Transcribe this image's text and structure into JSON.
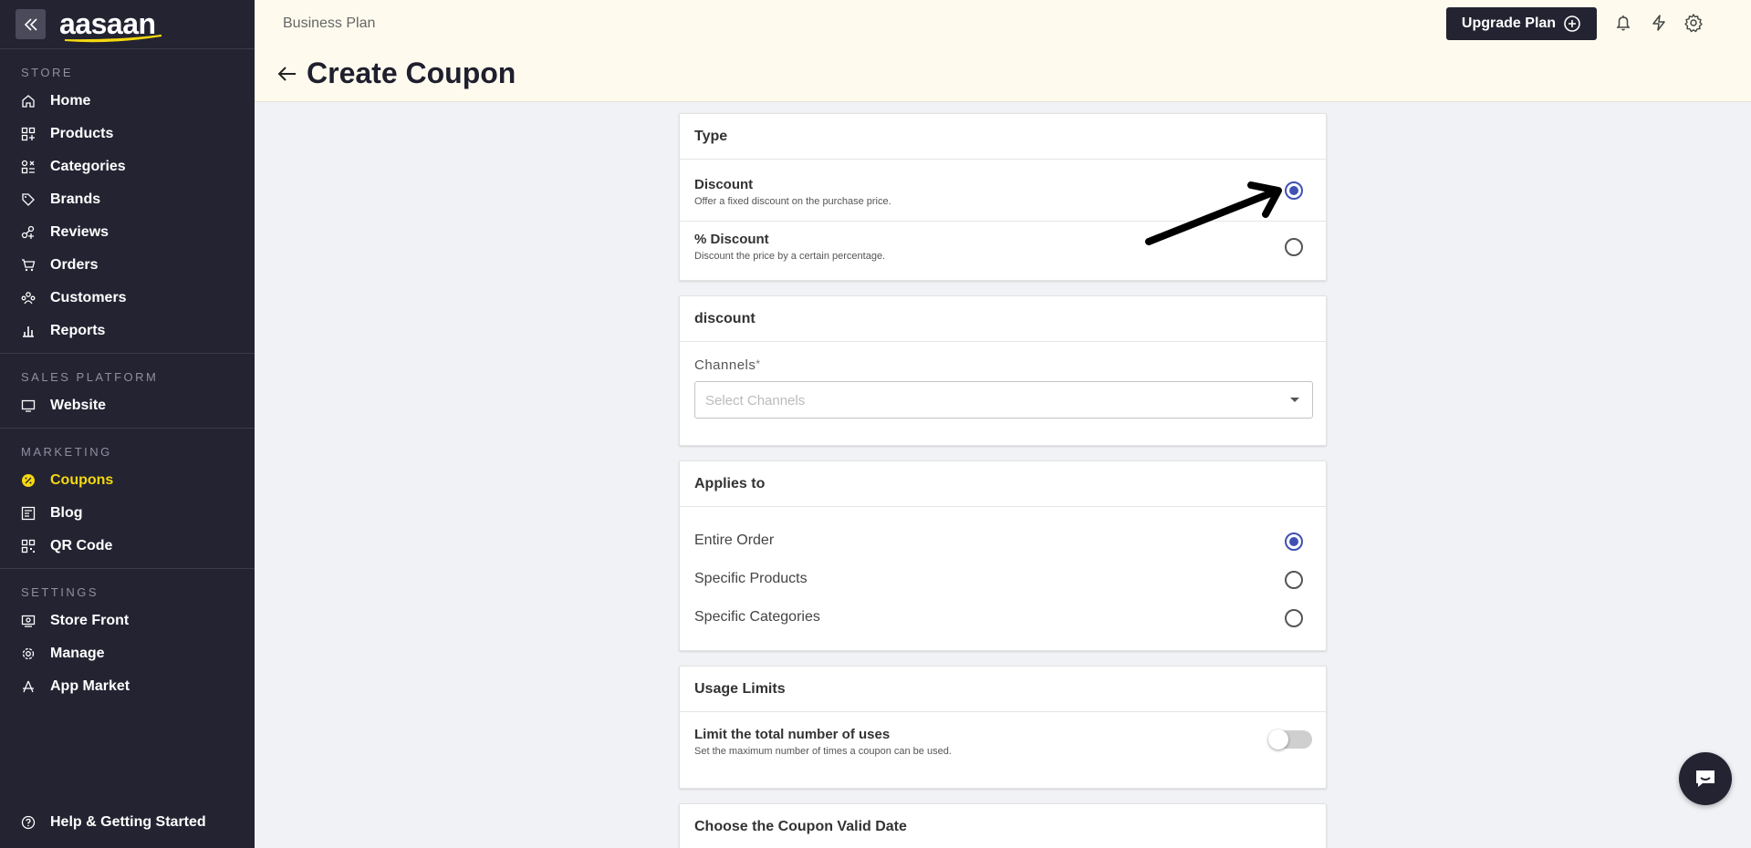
{
  "sidebar": {
    "logo": "aasaan",
    "sections": {
      "store": {
        "title": "STORE",
        "items": [
          "Home",
          "Products",
          "Categories",
          "Brands",
          "Reviews",
          "Orders",
          "Customers",
          "Reports"
        ]
      },
      "sales": {
        "title": "SALES PLATFORM",
        "items": [
          "Website"
        ]
      },
      "marketing": {
        "title": "MARKETING",
        "items": [
          "Coupons",
          "Blog",
          "QR Code"
        ]
      },
      "settings": {
        "title": "SETTINGS",
        "items": [
          "Store Front",
          "Manage",
          "App Market"
        ]
      }
    },
    "help": "Help & Getting Started",
    "active_item": "Coupons",
    "active_color": "#f5d80f"
  },
  "header": {
    "plan": "Business Plan",
    "upgrade": "Upgrade Plan",
    "title": "Create Coupon"
  },
  "type_card": {
    "title": "Type",
    "options": [
      {
        "title": "Discount",
        "desc": "Offer a fixed discount on the purchase price.",
        "selected": true
      },
      {
        "title": "% Discount",
        "desc": "Discount the price by a certain percentage.",
        "selected": false
      }
    ]
  },
  "discount_card": {
    "title": "discount",
    "channels_label": "Channels",
    "required_mark": "*",
    "channels_placeholder": "Select Channels"
  },
  "applies_card": {
    "title": "Applies to",
    "options": [
      {
        "label": "Entire Order",
        "selected": true
      },
      {
        "label": "Specific Products",
        "selected": false
      },
      {
        "label": "Specific Categories",
        "selected": false
      }
    ]
  },
  "usage_card": {
    "title": "Usage Limits",
    "limit_title": "Limit the total number of uses",
    "limit_desc": "Set the maximum number of times a coupon can be used.",
    "limit_enabled": false
  },
  "valid_card": {
    "title": "Choose the Coupon Valid Date"
  },
  "colors": {
    "sidebar_bg": "#232332",
    "header_bg": "#fefbee",
    "radio_selected": "#3f51b5"
  }
}
